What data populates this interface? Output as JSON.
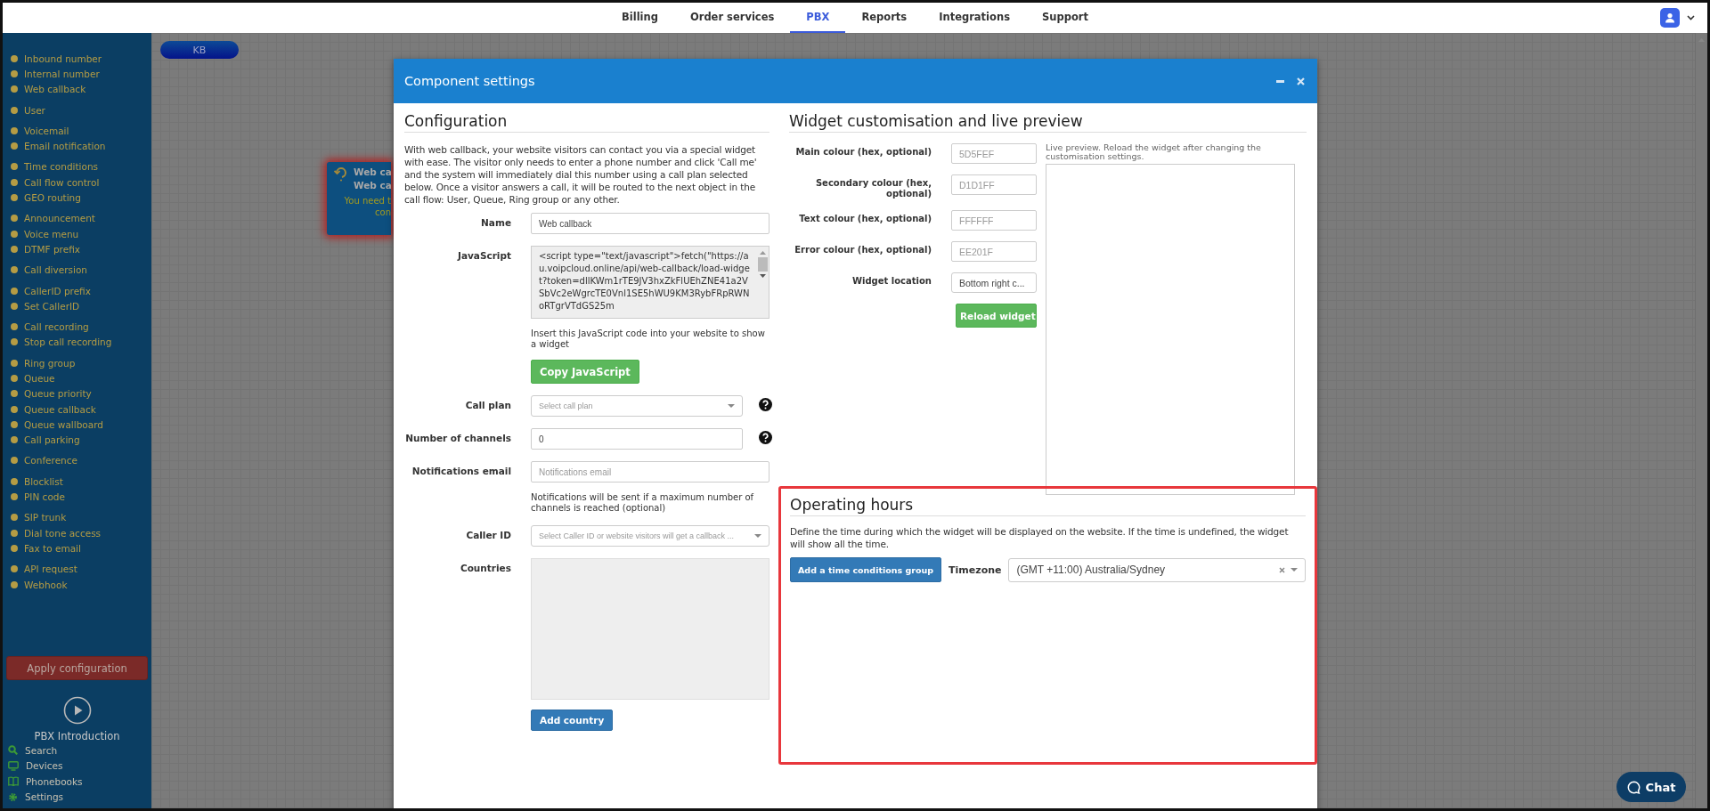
{
  "nav": {
    "tabs": [
      {
        "label": "Billing",
        "selected": false
      },
      {
        "label": "Order services",
        "selected": false
      },
      {
        "label": "PBX",
        "selected": true
      },
      {
        "label": "Reports",
        "selected": false
      },
      {
        "label": "Integrations",
        "selected": false
      },
      {
        "label": "Support",
        "selected": false
      }
    ]
  },
  "sidebar": {
    "groups": [
      {
        "items": [
          "Inbound number",
          "Internal number",
          "Web callback"
        ]
      },
      {
        "items": [
          "User"
        ]
      },
      {
        "items": [
          "Voicemail",
          "Email notification"
        ]
      },
      {
        "items": [
          "Time conditions",
          "Call flow control",
          "GEO routing"
        ]
      },
      {
        "items": [
          "Announcement",
          "Voice menu",
          "DTMF prefix"
        ]
      },
      {
        "items": [
          "Call diversion"
        ]
      },
      {
        "items": [
          "CallerID prefix",
          "Set CallerID"
        ]
      },
      {
        "items": [
          "Call recording",
          "Stop call recording"
        ]
      },
      {
        "items": [
          "Ring group",
          "Queue",
          "Queue priority",
          "Queue callback",
          "Queue wallboard",
          "Call parking"
        ]
      },
      {
        "items": [
          "Conference"
        ]
      },
      {
        "items": [
          "Blocklist",
          "PIN code"
        ]
      },
      {
        "items": [
          "SIP trunk",
          "Dial tone access",
          "Fax to email"
        ]
      },
      {
        "items": [
          "API request",
          "Webhook"
        ]
      }
    ],
    "apply_button": "Apply configuration",
    "intro": "PBX Introduction",
    "tools": [
      "Search",
      "Devices",
      "Phonebooks",
      "Settings"
    ]
  },
  "canvas": {
    "start_node": "KB",
    "component_node": {
      "title": "Web ca",
      "subtitle": "Web ca",
      "warning": [
        "You need t",
        "con"
      ]
    }
  },
  "modal": {
    "title": "Component settings",
    "configuration": {
      "heading": "Configuration",
      "intro": "With web callback, your website visitors can contact you via a special widget with ease. The visitor only needs to enter a phone number and click 'Call me' and the system will immediately dial this number using a call plan selected below. Once a visitor answers a call, it will be routed to the next object in the call flow: User, Queue, Ring group or any other.",
      "fields": [
        {
          "kind": "text",
          "label": "Name",
          "value": "Web callback",
          "help": false
        },
        {
          "kind": "code",
          "label": "JavaScript",
          "value": "<script type=\"text/javascript\">fetch(\"https://au.voipcloud.online/api/web-callback/load-widget?token=dllKWm1rTE9JV3hxZkFlUEhZNE41a2VSbVc2eWgrcTE0Vnl1SE5hWU9KM3RybFRpRWNoRTgrVTdGS25m",
          "help": false
        },
        {
          "kind": "note",
          "text": "Insert this JavaScript code into your website to show a widget"
        },
        {
          "kind": "button",
          "text": "Copy JavaScript"
        },
        {
          "kind": "select",
          "label": "Call plan",
          "placeholder": "Select call plan",
          "help": true
        },
        {
          "kind": "text",
          "label": "Number of channels",
          "value": "0",
          "help": true
        },
        {
          "kind": "text",
          "label": "Notifications email",
          "placeholder": "Notifications email",
          "help": false
        },
        {
          "kind": "note",
          "text": "Notifications will be sent if a maximum number of channels is reached (optional)"
        },
        {
          "kind": "select",
          "label": "Caller ID",
          "placeholder": "Select Caller ID or website visitors will get a callback ...",
          "help": false
        },
        {
          "kind": "list",
          "label": "Countries",
          "help": false
        },
        {
          "kind": "button",
          "text": "Add country"
        }
      ]
    },
    "widget": {
      "heading": "Widget customisation and live preview",
      "fields": [
        {
          "kind": "text",
          "label": "Main colour (hex, optional)",
          "placeholder": "5D5FEF"
        },
        {
          "kind": "text",
          "label": "Secondary colour (hex, optional)",
          "placeholder": "D1D1FF"
        },
        {
          "kind": "text",
          "label": "Text colour (hex, optional)",
          "placeholder": "FFFFFF"
        },
        {
          "kind": "text",
          "label": "Error colour (hex, optional)",
          "placeholder": "EE201F"
        },
        {
          "kind": "select",
          "label": "Widget location",
          "value": "Bottom right c..."
        }
      ],
      "reload_button": "Reload widget",
      "preview_note": "Live preview. Reload the widget after changing the customisation settings."
    },
    "operating_hours": {
      "heading": "Operating hours",
      "highlighted": true,
      "description": "Define the time during which the widget will be displayed on the website. If the time is undefined, the widget will show all the time.",
      "add_button": "Add a time conditions group",
      "timezone_label": "Timezone",
      "timezone": {
        "value": "(GMT +11:00) Australia/Sydney",
        "clearable": true
      }
    }
  },
  "chat_button": "Chat"
}
